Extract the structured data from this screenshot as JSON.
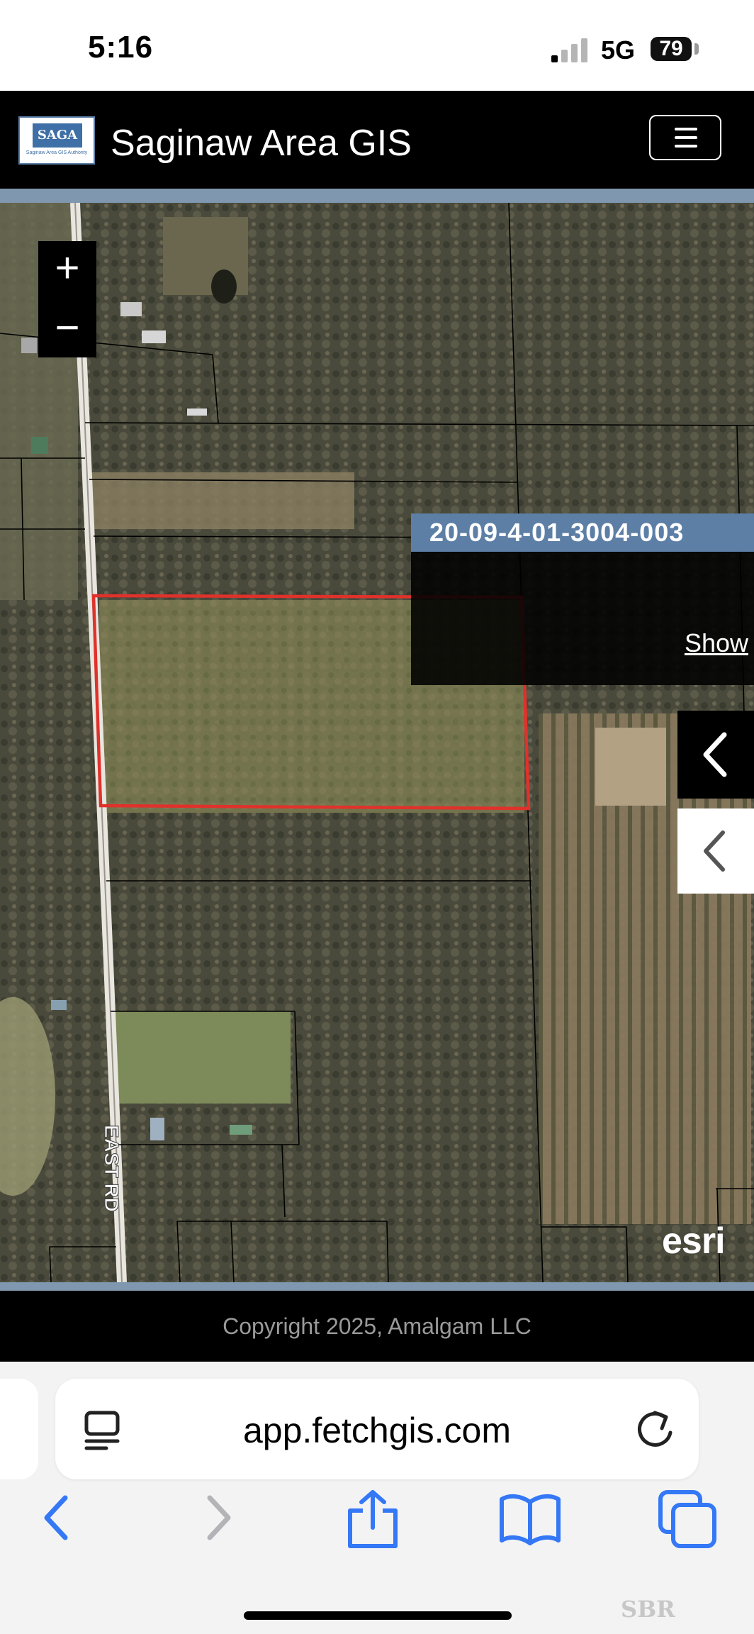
{
  "status_bar": {
    "time": "5:16",
    "network": "5G",
    "battery": "79"
  },
  "header": {
    "logo_text": "SAGA",
    "logo_subtext": "Saginaw Area GIS Authority",
    "title": "Saginaw Area GIS",
    "menu_icon": "hamburger-icon"
  },
  "map": {
    "zoom_in_label": "+",
    "zoom_out_label": "−",
    "road_label": "EAST RD",
    "parcel_id": "20-09-4-01-3004-003",
    "parcel_show_label": "Show",
    "attribution": "esri",
    "selection_color": "#e0312b",
    "panel_accent": "#5d7fa6"
  },
  "footer": {
    "copyright": "Copyright 2025, Amalgam LLC"
  },
  "browser": {
    "url": "app.fetchgis.com",
    "accent": "#3478f6",
    "toolbar_icons": [
      "back-icon",
      "forward-icon",
      "share-icon",
      "bookmarks-icon",
      "tabs-icon"
    ]
  },
  "watermark": "SBR"
}
